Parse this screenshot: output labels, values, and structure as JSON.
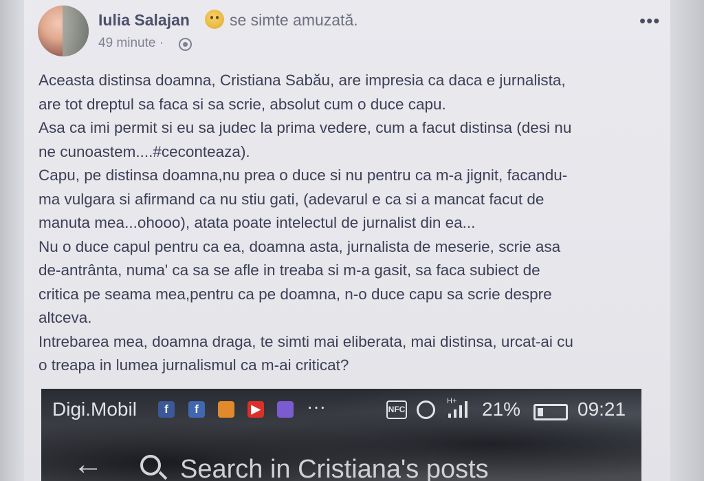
{
  "post": {
    "author": "Iulia Salajan",
    "feeling": "se simte amuzată.",
    "time": "49 minute ·",
    "more": "•••",
    "lines": [
      "Aceasta distinsa doamna, Cristiana Sabău, are impresia ca daca e jurnalista,",
      "are tot dreptul sa faca si sa scrie, absolut cum o duce capu.",
      "Asa ca imi permit si eu sa judec la prima vedere, cum a facut distinsa (desi nu",
      "ne cunoastem....#ceconteaza).",
      "Capu, pe distinsa doamna,nu prea o duce si nu pentru ca m-a jignit, facandu-",
      "ma vulgara si afirmand ca nu stiu gati, (adevarul e ca si a mancat facut de",
      "manuta mea...ohooo), atata poate intelectul de jurnalist din ea...",
      "Nu o duce capul pentru ca ea, doamna asta, jurnalista de meserie, scrie asa",
      "de-antrânta, numa' ca sa se afle in treaba si m-a gasit, sa faca subiect de",
      "critica pe seama mea,pentru ca pe doamna, n-o duce capu sa scrie despre",
      "altceva.",
      "Intrebarea mea, doamna draga, te simti mai eliberata, mai distinsa, urcat-ai cu",
      "o treapa in lumea jurnalismul ca m-ai criticat?"
    ]
  },
  "screenshot": {
    "carrier": "Digi.Mobil",
    "dots": "···",
    "nfc": "NFC",
    "network": "H+",
    "battery": "21%",
    "time": "09:21",
    "search_placeholder": "Search in Cristiana's posts",
    "colors": {
      "facebook": "#3b5998",
      "messenger": "#4267b2",
      "orange": "#e08a2c",
      "youtube": "#d9302a",
      "gallery": "#7a5bd0"
    }
  }
}
